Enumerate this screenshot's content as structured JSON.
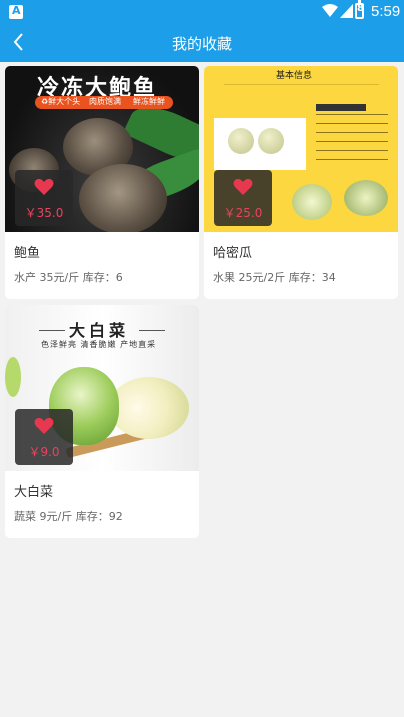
{
  "status_bar": {
    "time": "5:59",
    "app_indicator": "A",
    "battery_label": "8"
  },
  "app_bar": {
    "title": "我的收藏"
  },
  "cards": [
    {
      "name": "鲍鱼",
      "price": "￥35.0",
      "meta": "水产  35元/斤 库存：6",
      "image_title": "冷冻大鲍鱼",
      "image_tags": [
        "♻鲜大个头",
        "肉质饱满",
        "鲜冻鲜鲜"
      ]
    },
    {
      "name": "哈密瓜",
      "price": "￥25.0",
      "meta": "水果  25元/2斤 库存：34",
      "image_title": "基本信息"
    },
    {
      "name": "大白菜",
      "price": "￥9.0",
      "meta": "蔬菜  9元/斤 库存：92",
      "image_title": "大白菜",
      "image_subtitle": "色泽鲜亮  清香脆嫩  产地直采"
    }
  ],
  "colors": {
    "primary": "#1c9ee8",
    "price_text": "#e8445e",
    "heart": "#e8384f"
  }
}
